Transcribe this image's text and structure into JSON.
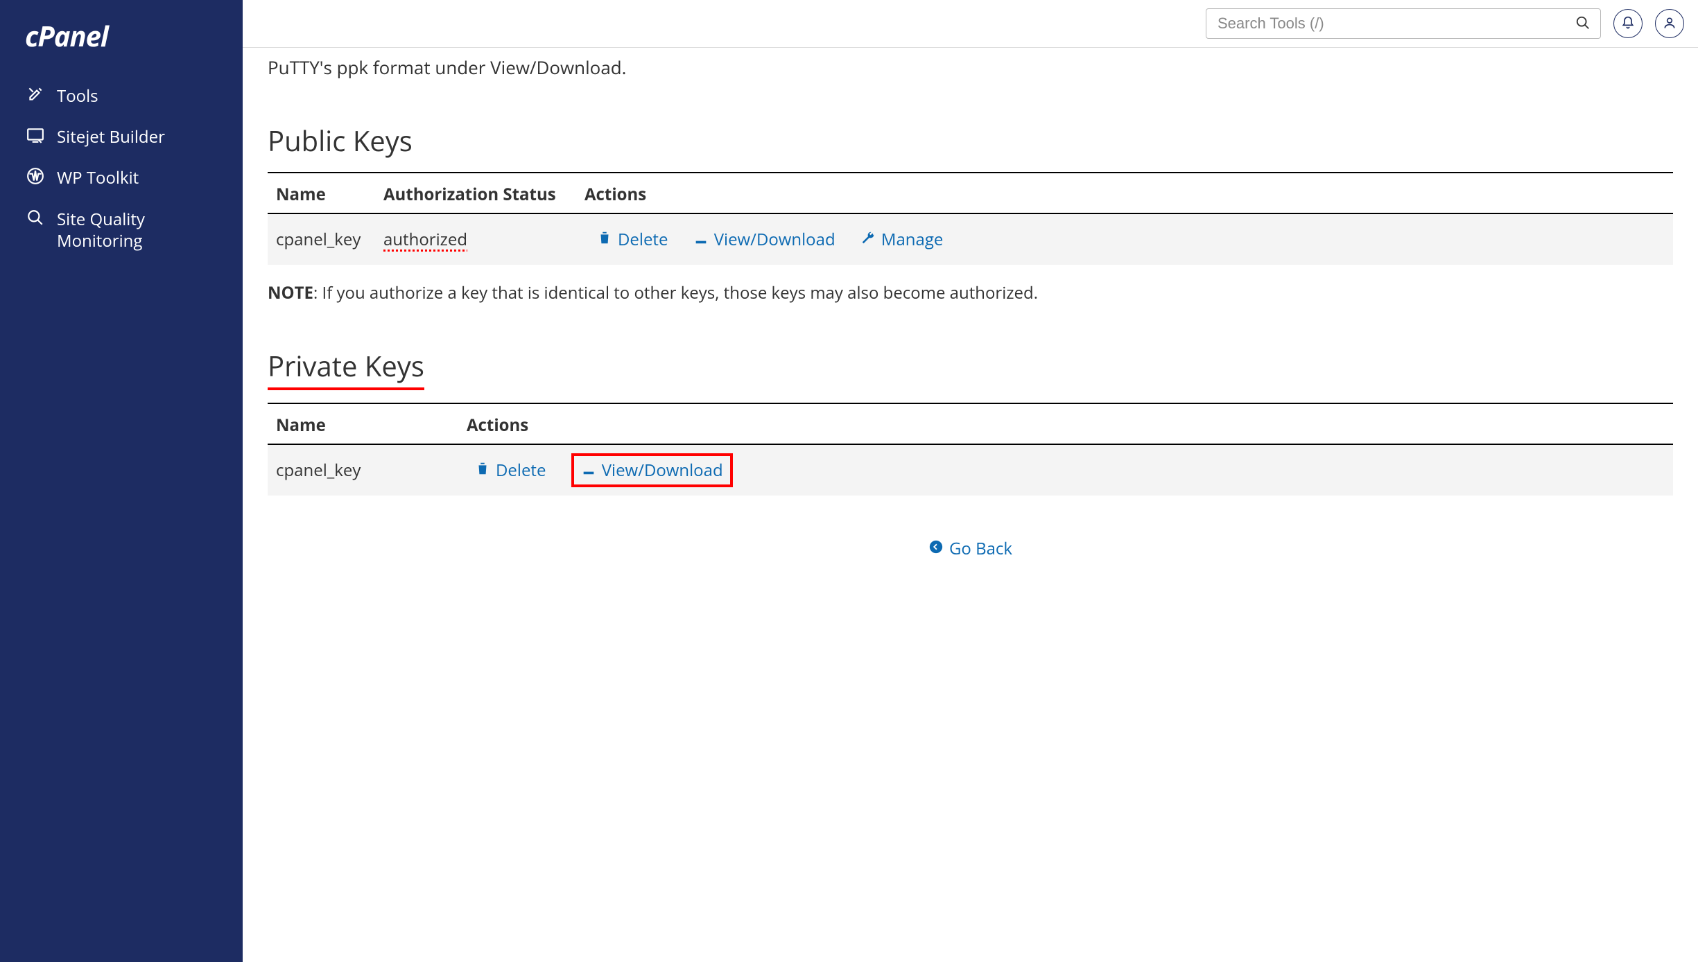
{
  "brand": "cPanel",
  "sidebar": {
    "items": [
      {
        "label": "Tools"
      },
      {
        "label": "Sitejet Builder"
      },
      {
        "label": "WP Toolkit"
      },
      {
        "label": "Site Quality Monitoring"
      }
    ]
  },
  "search": {
    "placeholder": "Search Tools (/)"
  },
  "partial_line": "PuTTY's ppk format under View/Download.",
  "public_keys": {
    "heading": "Public Keys",
    "columns": {
      "name": "Name",
      "auth": "Authorization Status",
      "actions": "Actions"
    },
    "rows": [
      {
        "name": "cpanel_key",
        "auth": "authorized",
        "actions": {
          "delete": "Delete",
          "view": "View/Download",
          "manage": "Manage"
        }
      }
    ],
    "note_label": "NOTE",
    "note_text": ": If you authorize a key that is identical to other keys, those keys may also become authorized."
  },
  "private_keys": {
    "heading": "Private Keys",
    "columns": {
      "name": "Name",
      "actions": "Actions"
    },
    "rows": [
      {
        "name": "cpanel_key",
        "actions": {
          "delete": "Delete",
          "view": "View/Download"
        }
      }
    ]
  },
  "go_back": "Go Back"
}
